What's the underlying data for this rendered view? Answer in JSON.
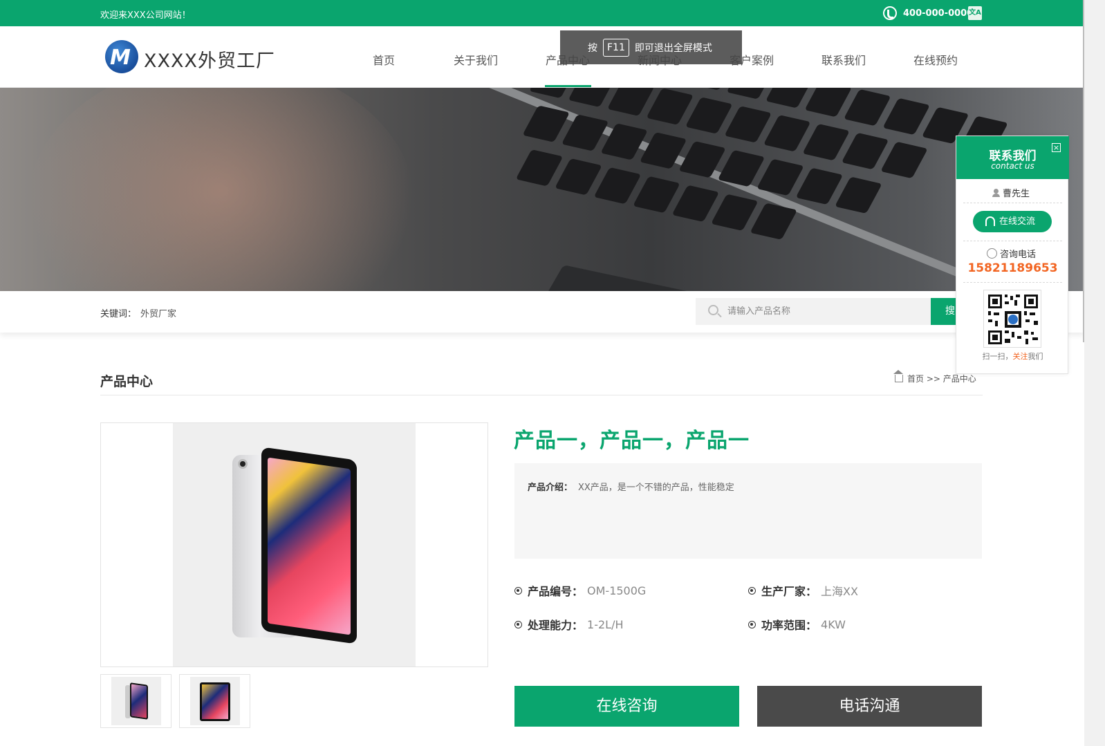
{
  "topbar": {
    "welcome": "欢迎来XXX公司网站！",
    "phone": "400-000-0000",
    "lang_icon": "translate-icon"
  },
  "header": {
    "logo_text": "XXXX外贸工厂",
    "nav": [
      "首页",
      "关于我们",
      "产品中心",
      "新闻中心",
      "客户案例",
      "联系我们",
      "在线预约"
    ],
    "active_nav": "产品中心"
  },
  "overlay": {
    "press": "按",
    "key": "F11",
    "message": "即可退出全屏模式"
  },
  "search": {
    "keyword_label": "关键词：",
    "keyword_value": "外贸厂家",
    "placeholder": "请输入产品名称",
    "button_label": "搜"
  },
  "section": {
    "title": "产品中心",
    "breadcrumb": "首页 >> 产品中心"
  },
  "product": {
    "title": "产品一，产品一，产品一",
    "intro_label": "产品介绍：",
    "intro_text": "XX产品，是一个不错的产品，性能稳定",
    "attributes": [
      {
        "label": "产品编号：",
        "value": "OM-1500G"
      },
      {
        "label": "生产厂家：",
        "value": "上海XX"
      },
      {
        "label": "处理能力：",
        "value": "1-2L/H"
      },
      {
        "label": "功率范围：",
        "value": "4KW"
      }
    ],
    "consult_button": "在线咨询",
    "phone_button": "电话沟通"
  },
  "contact_panel": {
    "title": "联系我们",
    "subtitle": "contact us",
    "close": "×",
    "person": "曹先生",
    "chat_button": "在线交流",
    "tel_label": "咨询电话",
    "tel": "15821189653",
    "scan_pre": "扫一扫，",
    "scan_highlight": "关注",
    "scan_post": "我们"
  },
  "colors": {
    "brand_green": "#0aa56e",
    "dark_button": "#4a4a4a",
    "tel_orange": "#f26522"
  }
}
